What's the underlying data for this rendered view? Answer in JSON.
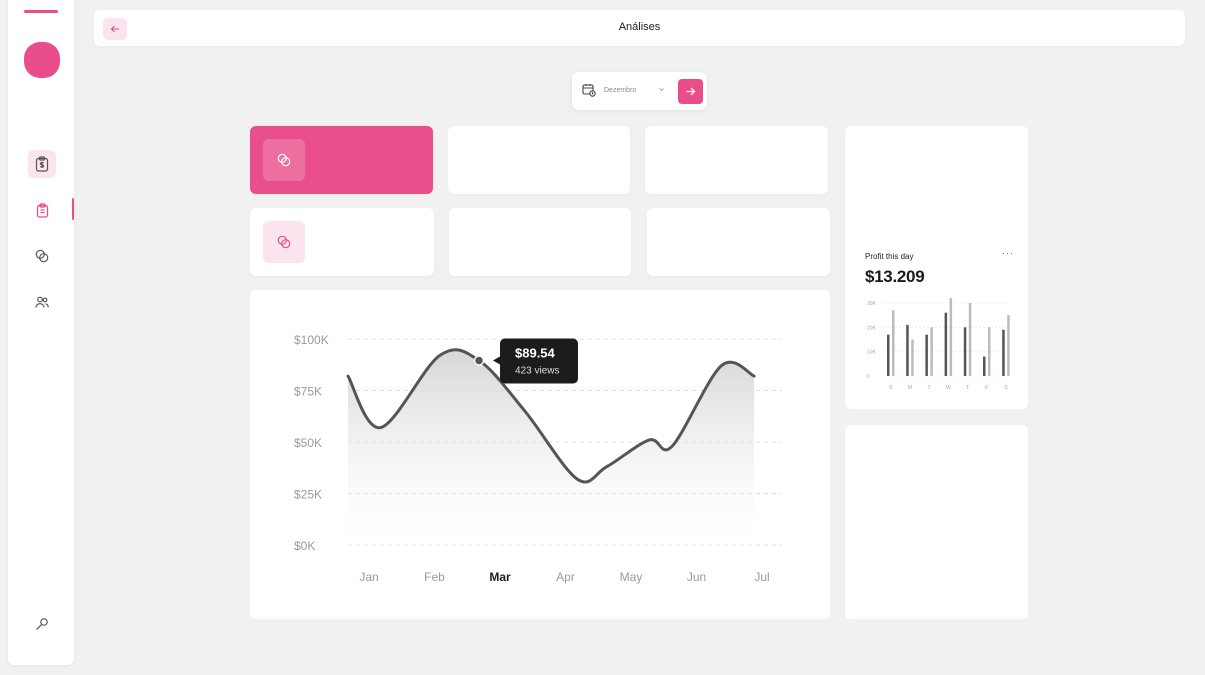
{
  "header": {
    "title": "Análises"
  },
  "sidebar": {
    "items": [
      {
        "icon": "dollar-clipboard-icon"
      },
      {
        "icon": "clipboard-icon"
      },
      {
        "icon": "overlap-circles-icon"
      },
      {
        "icon": "users-icon"
      }
    ],
    "bottom_icon": "wrench-icon"
  },
  "month_picker": {
    "value": "Dezembro"
  },
  "colors": {
    "accent": "#e94d8a",
    "accent_light": "#fbe4ee",
    "line": "#555555",
    "grid": "#dcdcdc"
  },
  "chart_data": [
    {
      "type": "area",
      "categories": [
        "Jan",
        "Feb",
        "Mar",
        "Apr",
        "May",
        "Jun",
        "Jul"
      ],
      "y_tick_labels": [
        "$100K",
        "$75K",
        "$50K",
        "$25K",
        "$0K"
      ],
      "ylim": [
        0,
        100000
      ],
      "grid": true,
      "highlight_category": "Mar",
      "series": [
        {
          "x": [
            0.0,
            0.5,
            1.4,
            2.0,
            2.7,
            3.5,
            3.95,
            4.6,
            4.95,
            5.7,
            6.2
          ],
          "values": [
            82000,
            57000,
            92000,
            89540,
            65000,
            32000,
            38000,
            51000,
            48000,
            87000,
            82000
          ]
        }
      ],
      "tooltip": {
        "value": "$89.54",
        "detail": "423 views"
      }
    },
    {
      "type": "bar",
      "label": "Profit this day",
      "value": "$13.209",
      "categories": [
        "S",
        "M",
        "T",
        "W",
        "T",
        "F",
        "S"
      ],
      "y_tick_labels": [
        "30K",
        "20K",
        "10K",
        "0"
      ],
      "ylim": [
        0,
        30000
      ],
      "series": [
        {
          "color": "#555555",
          "values": [
            17000,
            21000,
            17000,
            26000,
            20000,
            8000,
            19000
          ]
        },
        {
          "color": "#bbbbbb",
          "values": [
            27000,
            15000,
            20000,
            32000,
            30000,
            20000,
            25000
          ]
        }
      ]
    }
  ]
}
